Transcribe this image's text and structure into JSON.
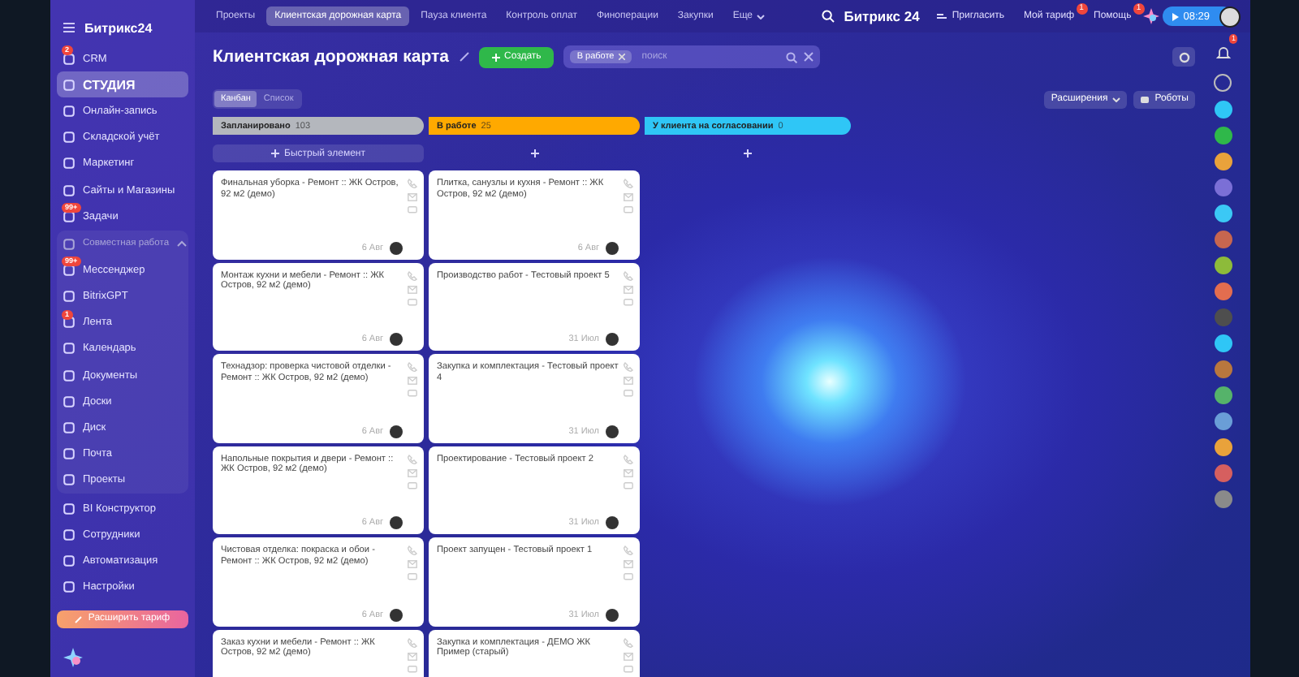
{
  "sidebar": {
    "logo": "Битрикс24",
    "items": [
      {
        "kind": "item",
        "label": "CRM",
        "selected": false,
        "badge": "2"
      },
      {
        "kind": "item",
        "label": "СТУДИЯ",
        "selected": true
      },
      {
        "kind": "item",
        "label": "Онлайн-запись",
        "selected": false
      },
      {
        "kind": "item",
        "label": "Складской учёт",
        "selected": false
      },
      {
        "kind": "item",
        "label": "Маркетинг",
        "selected": false
      },
      {
        "kind": "item",
        "label": "Сайты и Магазины",
        "selected": false
      },
      {
        "kind": "item",
        "label": "Задачи",
        "selected": false,
        "badge": "99+"
      },
      {
        "kind": "group",
        "label": "Совместная работа",
        "expanded": true,
        "children": [
          {
            "kind": "item",
            "label": "Мессенджер",
            "selected": false,
            "badge": "99+"
          },
          {
            "kind": "item",
            "label": "BitrixGPT",
            "selected": false
          },
          {
            "kind": "item",
            "label": "Лента",
            "selected": false,
            "badge": "1"
          },
          {
            "kind": "item",
            "label": "Календарь",
            "selected": false
          },
          {
            "kind": "item",
            "label": "Документы",
            "selected": false
          },
          {
            "kind": "item",
            "label": "Доски",
            "selected": false
          },
          {
            "kind": "item",
            "label": "Диск",
            "selected": false
          },
          {
            "kind": "item",
            "label": "Почта",
            "selected": false
          },
          {
            "kind": "item",
            "label": "Проекты",
            "selected": false
          }
        ]
      },
      {
        "kind": "item",
        "label": "BI Конструктор",
        "selected": false
      },
      {
        "kind": "item",
        "label": "Сотрудники",
        "selected": false
      },
      {
        "kind": "item",
        "label": "Автоматизация",
        "selected": false
      },
      {
        "kind": "item",
        "label": "Настройки",
        "selected": false
      }
    ],
    "upgrade_button": "Расширить тариф"
  },
  "tabs": [
    {
      "label": "Проекты",
      "selected": false
    },
    {
      "label": "Клиентская дорожная карта",
      "selected": true
    },
    {
      "label": "Пауза клиента",
      "selected": false
    },
    {
      "label": "Контроль оплат",
      "selected": false
    },
    {
      "label": "Финоперации",
      "selected": false
    },
    {
      "label": "Закупки",
      "selected": false
    },
    {
      "label": "Еще",
      "selected": false
    }
  ],
  "header": {
    "brand": "Битрикс 24",
    "invite": "Пригласить",
    "tariff": {
      "label": "Мой тариф",
      "badge": "1"
    },
    "help": {
      "label": "Помощь",
      "badge": "1"
    },
    "timer": "08:29"
  },
  "page": {
    "title": "Клиентская дорожная карта",
    "create_button": "Создать",
    "filter": {
      "tag": "В работе",
      "placeholder": "поиск"
    },
    "views": [
      {
        "label": "Канбан",
        "selected": true
      },
      {
        "label": "Список",
        "selected": false
      }
    ],
    "extensions_button": "Расширения",
    "robots_button": "Роботы",
    "notifications_badge": "1"
  },
  "columns": [
    {
      "title": "Запланировано",
      "count": "103",
      "color": "#b4b7bd",
      "quick_add": "Быстрый элемент",
      "cards": [
        {
          "title": "Финальная уборка - Ремонт :: ЖК Остров, 92 м2 (демо)",
          "date": "6 Авг"
        },
        {
          "title": "Монтаж кухни и мебели - Ремонт :: ЖК Остров, 92 м2 (демо)",
          "date": "6 Авг"
        },
        {
          "title": "Технадзор: проверка чистовой отделки - Ремонт :: ЖК Остров, 92 м2 (демо)",
          "date": "6 Авг"
        },
        {
          "title": "Напольные покрытия и двери - Ремонт :: ЖК Остров, 92 м2 (демо)",
          "date": "6 Авг"
        },
        {
          "title": "Чистовая отделка: покраска и обои - Ремонт :: ЖК Остров, 92 м2 (демо)",
          "date": "6 Авг"
        },
        {
          "title": "Заказ кухни и мебели - Ремонт :: ЖК Остров, 92 м2 (демо)"
        }
      ]
    },
    {
      "title": "В работе",
      "count": "25",
      "color": "#ffa900",
      "cards": [
        {
          "title": "Плитка, санузлы и кухня - Ремонт :: ЖК Остров, 92 м2 (демо)",
          "date": "6 Авг"
        },
        {
          "title": "Производство работ - Тестовый проект 5",
          "date": "31 Июл"
        },
        {
          "title": "Закупка и комплектация - Тестовый проект 4",
          "date": "31 Июл"
        },
        {
          "title": "Проектирование - Тестовый проект 2",
          "date": "31 Июл"
        },
        {
          "title": "Проект запущен - Тестовый проект 1",
          "date": "31 Июл"
        },
        {
          "title": "Закупка и комплектация - ДЕМО ЖК Пример (старый)"
        }
      ]
    },
    {
      "title": "У клиента на согласовании",
      "count": "0",
      "color": "#2fc6f6"
    }
  ]
}
